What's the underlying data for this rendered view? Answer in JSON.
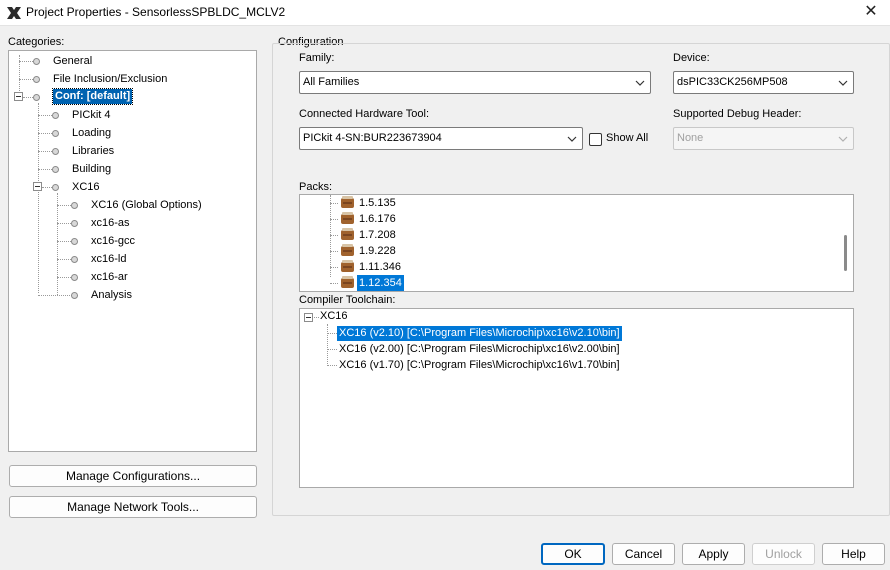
{
  "window": {
    "title": "Project Properties - SensorlessSPBLDC_MCLV2",
    "close_glyph": "✕"
  },
  "categories": {
    "label": "Categories:",
    "items": [
      {
        "label": "General"
      },
      {
        "label": "File Inclusion/Exclusion"
      },
      {
        "label": "Conf: [default]"
      },
      {
        "label": "PICkit 4"
      },
      {
        "label": "Loading"
      },
      {
        "label": "Libraries"
      },
      {
        "label": "Building"
      },
      {
        "label": "XC16"
      },
      {
        "label": "XC16 (Global Options)"
      },
      {
        "label": "xc16-as"
      },
      {
        "label": "xc16-gcc"
      },
      {
        "label": "xc16-ld"
      },
      {
        "label": "xc16-ar"
      },
      {
        "label": "Analysis"
      }
    ]
  },
  "buttons": {
    "manage_configurations": "Manage Configurations...",
    "manage_network_tools": "Manage Network Tools...",
    "ok": "OK",
    "cancel": "Cancel",
    "apply": "Apply",
    "unlock": "Unlock",
    "help": "Help"
  },
  "configuration": {
    "group_label": "Configuration",
    "family_label": "Family:",
    "family_value": "All Families",
    "device_label": "Device:",
    "device_value": "dsPIC33CK256MP508",
    "hardware_tool_label": "Connected Hardware Tool:",
    "hardware_tool_value": "PICkit 4-SN:BUR223673904",
    "show_all_label": "Show All",
    "show_all_checked": false,
    "debug_header_label": "Supported Debug Header:",
    "debug_header_value": "None",
    "packs_label": "Packs:",
    "packs": [
      "1.5.135",
      "1.6.176",
      "1.7.208",
      "1.9.228",
      "1.11.346",
      "1.12.354"
    ],
    "packs_selected": "1.12.354",
    "compiler_label": "Compiler Toolchain:",
    "compiler_root": "XC16",
    "toolchains": [
      "XC16 (v2.10) [C:\\Program Files\\Microchip\\xc16\\v2.10\\bin]",
      "XC16 (v2.00) [C:\\Program Files\\Microchip\\xc16\\v2.00\\bin]",
      "XC16 (v1.70) [C:\\Program Files\\Microchip\\xc16\\v1.70\\bin]"
    ],
    "toolchain_selected": "XC16 (v2.10) [C:\\Program Files\\Microchip\\xc16\\v2.10\\bin]"
  },
  "colors": {
    "selection": "#0078d7",
    "primary_button_border": "#0067c0"
  }
}
